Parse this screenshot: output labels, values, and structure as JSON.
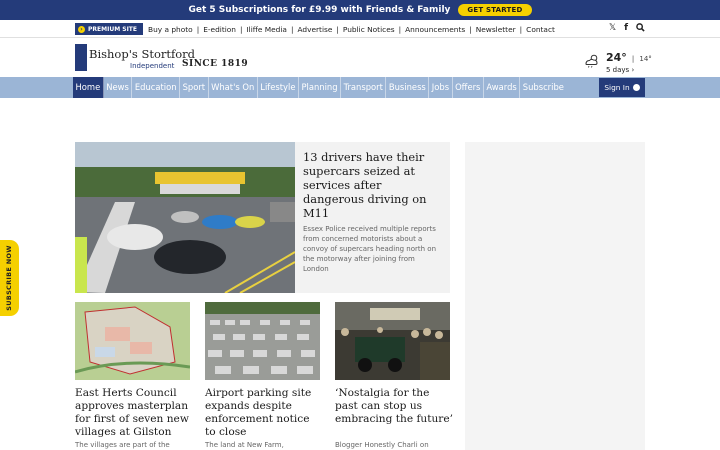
{
  "promo": {
    "text": "Get 5 Subscriptions for £9.99 with Friends & Family",
    "cta": "GET STARTED"
  },
  "utility": {
    "premium_label": "PREMIUM SITE",
    "links": [
      "Buy a photo",
      "E-edition",
      "Iliffe Media",
      "Advertise",
      "Public Notices",
      "Announcements",
      "Newsletter",
      "Contact"
    ],
    "separator": "|",
    "icons": [
      "x-icon",
      "facebook-icon",
      "search-icon"
    ]
  },
  "logo": {
    "name": "Bishop's Stortford",
    "sub": "Independent",
    "since": "SINCE 1819"
  },
  "weather": {
    "temp": "24°",
    "sep": "|",
    "low": "14°",
    "days": "5 days",
    "icon": "partly-cloudy-rain-icon"
  },
  "nav": {
    "items": [
      "Home",
      "News",
      "Education",
      "Sport",
      "What's On",
      "Lifestyle",
      "Planning",
      "Transport",
      "Business",
      "Jobs",
      "Offers",
      "Awards",
      "Subscribe"
    ],
    "active": "Home",
    "signin": "Sign In"
  },
  "side_tab": "SUBSCRIBE NOW",
  "hero": {
    "title": "13 drivers have their supercars seized at services after dangerous driving on M11",
    "desc": "Essex Police received multiple reports from concerned motorists about a convoy of supercars heading north on the motorway after joining from London"
  },
  "cards": [
    {
      "title": "East Herts Council approves masterplan for first of seven new villages at Gilston",
      "desc": "The villages are part of the"
    },
    {
      "title": "Airport parking site expands despite enforcement notice to close",
      "desc": "The land at New Farm,"
    },
    {
      "title": "‘Nostalgia for the past can stop us embracing the future’",
      "desc": "Blogger Honestly Charli on"
    }
  ],
  "colors": {
    "brand_navy": "#243b7a",
    "nav_blue": "#9bb5d6",
    "accent_yellow": "#f5d000"
  }
}
